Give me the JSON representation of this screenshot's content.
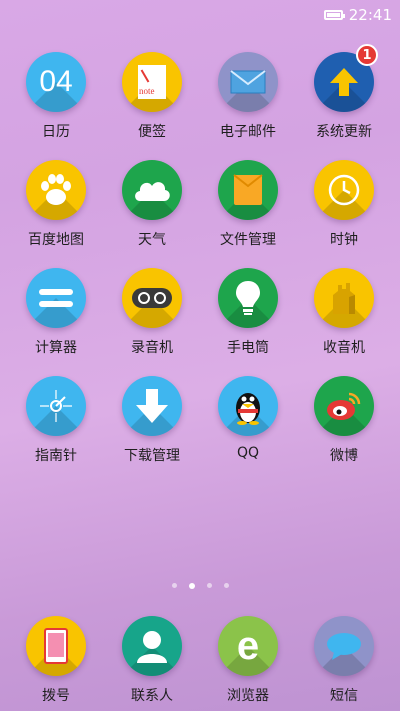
{
  "status": {
    "time": "22:41"
  },
  "apps": [
    {
      "label": "日历",
      "icon": "calendar-icon",
      "text": "04",
      "color": "#3fb6ef"
    },
    {
      "label": "便签",
      "icon": "note-icon",
      "text": "note",
      "color": "#f9c400"
    },
    {
      "label": "电子邮件",
      "icon": "mail-icon",
      "color": "#8f93c9"
    },
    {
      "label": "系统更新",
      "icon": "update-arrow-icon",
      "color": "#1f5fb0",
      "badge": "1"
    },
    {
      "label": "百度地图",
      "icon": "paw-icon",
      "color": "#f9c400"
    },
    {
      "label": "天气",
      "icon": "cloud-icon",
      "color": "#1ea54c"
    },
    {
      "label": "文件管理",
      "icon": "folder-icon",
      "color": "#1ea54c"
    },
    {
      "label": "时钟",
      "icon": "clock-icon",
      "color": "#f9c400"
    },
    {
      "label": "计算器",
      "icon": "equals-icon",
      "color": "#3fb6ef"
    },
    {
      "label": "录音机",
      "icon": "cassette-icon",
      "color": "#f9c400"
    },
    {
      "label": "手电筒",
      "icon": "bulb-icon",
      "color": "#1ea54c"
    },
    {
      "label": "收音机",
      "icon": "radio-icon",
      "color": "#f9c400"
    },
    {
      "label": "指南针",
      "icon": "compass-icon",
      "color": "#3fb6ef"
    },
    {
      "label": "下载管理",
      "icon": "download-icon",
      "color": "#3fb6ef"
    },
    {
      "label": "QQ",
      "icon": "penguin-icon",
      "color": "#3fb6ef"
    },
    {
      "label": "微博",
      "icon": "weibo-icon",
      "color": "#1ea54c"
    }
  ],
  "page_indicator": {
    "count": 4,
    "active": 2
  },
  "dock": [
    {
      "label": "拨号",
      "icon": "phone-icon",
      "color": "#f9c400"
    },
    {
      "label": "联系人",
      "icon": "contact-icon",
      "color": "#17a58a"
    },
    {
      "label": "浏览器",
      "icon": "browser-icon",
      "text": "e",
      "color": "#8bc34a"
    },
    {
      "label": "短信",
      "icon": "message-icon",
      "color": "#8f93c9"
    }
  ]
}
